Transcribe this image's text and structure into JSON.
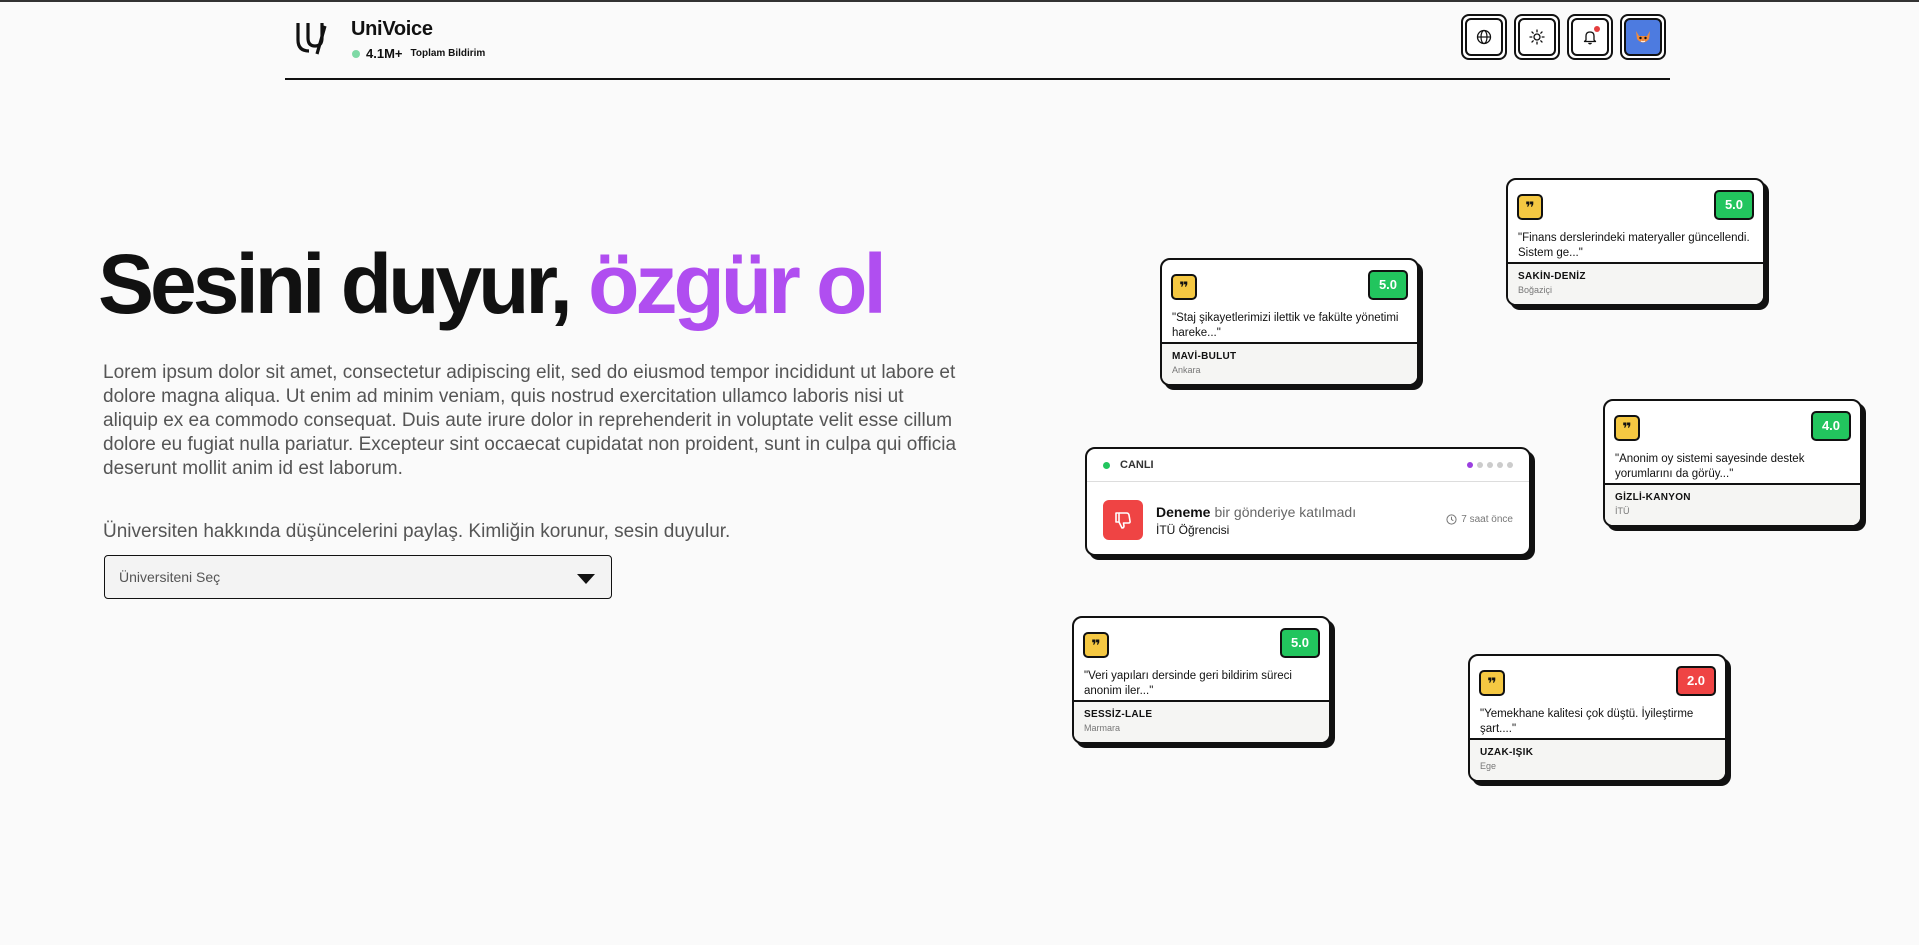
{
  "brand": {
    "title": "UniVoice",
    "stat_count": "4.1M+",
    "stat_label": "Toplam Bildirim"
  },
  "header_buttons": [
    {
      "icon": "globe-icon"
    },
    {
      "icon": "sun-icon"
    },
    {
      "icon": "bell-icon",
      "has_notification": true
    },
    {
      "icon": "avatar",
      "color": "#4d7be0"
    }
  ],
  "hero": {
    "title_main": "Sesini duyur,",
    "title_accent": "özgür ol",
    "accent_color": "#b04ef0",
    "description": "Lorem ipsum dolor sit amet, consectetur adipiscing elit, sed do eiusmod tempor incididunt ut labore et dolore magna aliqua. Ut enim ad minim veniam, quis nostrud exercitation ullamco laboris nisi ut aliquip ex ea commodo consequat. Duis aute irure dolor in reprehenderit in voluptate velit esse cillum dolore eu fugiat nulla pariatur. Excepteur sint occaecat cupidatat non proident, sunt in culpa qui officia deserunt mollit anim id est laborum.",
    "prompt": "Üniversiten hakkında düşüncelerini paylaş. Kimliğin korunur, sesin duyulur.",
    "select_placeholder": "Üniversiteni Seç"
  },
  "reviews": [
    {
      "score": "5.0",
      "quote": "\"Staj şikayetlerimizi ilettik ve fakülte yönetimi hareke...\"",
      "author": "MAVİ-BULUT",
      "university": "Ankara",
      "score_color": "green"
    },
    {
      "score": "5.0",
      "quote": "\"Finans derslerindeki materyaller güncellendi. Sistem ge...\"",
      "author": "SAKİN-DENİZ",
      "university": "Boğaziçi",
      "score_color": "green"
    },
    {
      "score": "4.0",
      "quote": "\"Anonim oy sistemi sayesinde destek yorumlarını da görüy...\"",
      "author": "GİZLİ-KANYON",
      "university": "İTÜ",
      "score_color": "green"
    },
    {
      "score": "5.0",
      "quote": "\"Veri yapıları dersinde geri bildirim süreci anonim iler...\"",
      "author": "SESSİZ-LALE",
      "university": "Marmara",
      "score_color": "green"
    },
    {
      "score": "2.0",
      "quote": "\"Yemekhane kalitesi çok düştü. İyileştirme şart....\"",
      "author": "UZAK-IŞIK",
      "university": "Ege",
      "score_color": "red"
    }
  ],
  "live": {
    "label": "CANLI",
    "name": "Deneme",
    "action": "bir gönderiye katılmadı",
    "subtitle": "İTÜ Öğrencisi",
    "time": "7 saat önce",
    "pager_total": 5,
    "pager_active": 1
  },
  "colors": {
    "score_green": "#22c55e",
    "score_red": "#ef4444",
    "quote_badge": "#f5c842"
  }
}
